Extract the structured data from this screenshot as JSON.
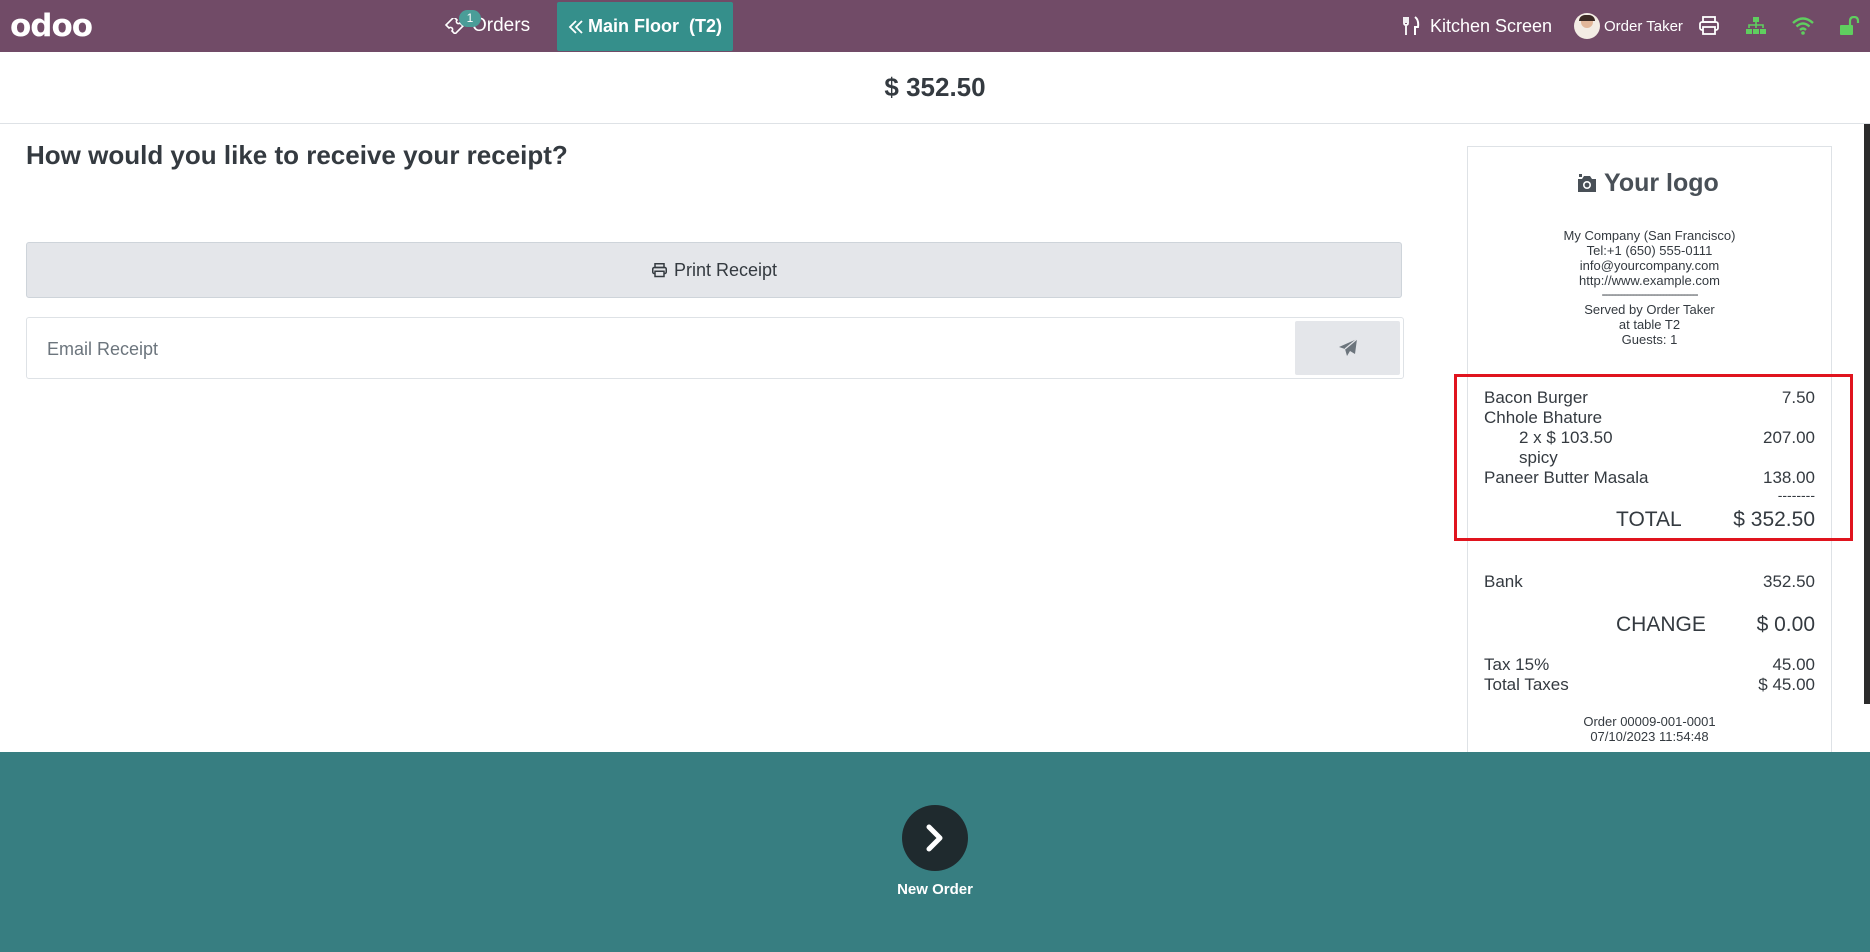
{
  "navbar": {
    "logo": "odoo",
    "orders_label": "Orders",
    "orders_badge": "1",
    "floor_label": "Main Floor  (T2)",
    "kitchen_label": "Kitchen Screen",
    "user_label": "Order Taker",
    "icons": [
      "ticket-icon",
      "double-chevron-left-icon",
      "fork-knife-icon",
      "printer-icon",
      "sitemap-icon",
      "wifi-icon",
      "unlock-icon"
    ],
    "status_color": "#5fce5f"
  },
  "amount": "$ 352.50",
  "question": "How would you like to receive your receipt?",
  "print_label": "Print Receipt",
  "email_placeholder": "Email Receipt",
  "receipt": {
    "logo_text": "Your logo",
    "company": [
      "My Company (San Francisco)",
      "Tel:+1 (650) 555-0111",
      "info@yourcompany.com",
      "http://www.example.com"
    ],
    "separator": "--------------------------------",
    "served": [
      "Served by Order Taker",
      "at table T2",
      "Guests: 1"
    ],
    "lines": [
      {
        "name": "Bacon Burger",
        "price": "7.50"
      },
      {
        "name": "Chhole Bhature",
        "price": ""
      },
      {
        "name": "2 x $ 103.50",
        "price": "207.00"
      },
      {
        "name": "spicy",
        "price": ""
      },
      {
        "name": "Paneer Butter Masala",
        "price": "138.00"
      }
    ],
    "dashes": "--------",
    "total_label": "TOTAL",
    "total_value": "$ 352.50",
    "payment_label": "Bank",
    "payment_value": "352.50",
    "change_label": "CHANGE",
    "change_value": "$ 0.00",
    "tax_label": "Tax 15%",
    "tax_value": "45.00",
    "total_taxes_label": "Total Taxes",
    "total_taxes_value": "$ 45.00",
    "order_ref": "Order 00009-001-0001",
    "order_date": "07/10/2023 11:54:48"
  },
  "new_order_label": "New Order",
  "colors": {
    "brand": "#714B67",
    "teal": "#377e81",
    "highlight": "#e0141e"
  }
}
